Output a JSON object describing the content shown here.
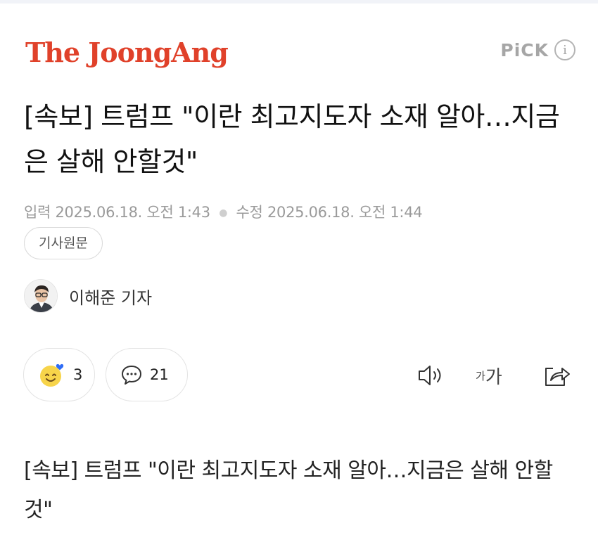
{
  "brand": {
    "logo_text": "The JoongAng",
    "pick_label": "PiCK",
    "info_icon_char": "i"
  },
  "article": {
    "headline": "[속보] 트럼프 \"이란 최고지도자 소재 알아…지금은 살해 안할것\"",
    "published_label": "입력",
    "published_time": "2025.06.18. 오전 1:43",
    "modified_label": "수정",
    "modified_time": "2025.06.18. 오전 1:44",
    "original_button": "기사원문",
    "author": "이해준 기자",
    "body": "[속보] 트럼프 \"이란 최고지도자 소재 알아…지금은 살해 안할것\""
  },
  "actions": {
    "reaction_icon": "smiley-heart-icon",
    "reaction_count": "3",
    "comment_icon": "comment-bubble-icon",
    "comment_count": "21",
    "audio_icon": "speaker-icon",
    "font_size_small": "가",
    "font_size_large": "가",
    "share_icon": "share-icon"
  },
  "colors": {
    "brand_red": "#e0412a",
    "meta_gray": "#9a9a9a",
    "reaction_yellow": "#f7d44a",
    "heart_blue": "#2f6df6"
  }
}
